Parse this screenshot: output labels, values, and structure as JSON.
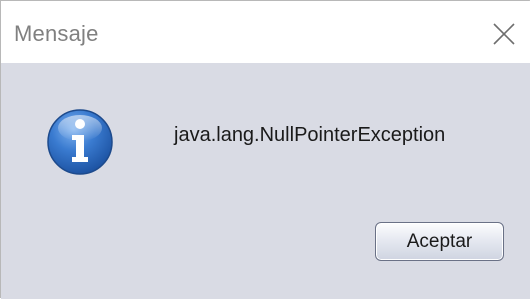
{
  "window": {
    "title": "Mensaje",
    "close_icon": "close-icon"
  },
  "dialog": {
    "icon": "information-icon",
    "message": "java.lang.NullPointerException",
    "accept_label": "Aceptar"
  },
  "colors": {
    "content_background": "#d9dbe4",
    "icon_blue": "#2f6fc6"
  }
}
